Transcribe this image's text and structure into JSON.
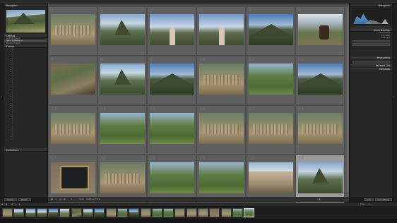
{
  "window": {
    "title": ""
  },
  "left_panel": {
    "navigator_label": "Navigator",
    "catalog_label": "Catalog",
    "catalog_items": [
      {
        "label": "All Photographs",
        "count": "",
        "selected": false
      },
      {
        "label": "Quick Collection +",
        "count": "",
        "selected": true
      },
      {
        "label": "Previous Import",
        "count": "",
        "selected": false
      }
    ],
    "folders_label": "Folders",
    "folder_tree": [
      "",
      "",
      "",
      "",
      "",
      "",
      "",
      "",
      "",
      "",
      "",
      "",
      "",
      "",
      "",
      "",
      "",
      "",
      "",
      "",
      "",
      "",
      "",
      "",
      "",
      "",
      "",
      "",
      "",
      "",
      "",
      "",
      "",
      "",
      "",
      "",
      "",
      "",
      "",
      "",
      ""
    ],
    "collections_label": "Collections",
    "buttons": {
      "import": "Import...",
      "export": "Export..."
    }
  },
  "grid": {
    "header": "",
    "cells": [
      {
        "index": "1",
        "kind": "k-ruin",
        "selected": false
      },
      {
        "index": "2",
        "kind": "k-peak",
        "selected": false
      },
      {
        "index": "3",
        "kind": "k-person",
        "selected": false
      },
      {
        "index": "4",
        "kind": "k-person",
        "selected": false
      },
      {
        "index": "5",
        "kind": "k-mtn",
        "selected": false
      },
      {
        "index": "6",
        "kind": "k-llama",
        "selected": false
      },
      {
        "index": "7",
        "kind": "k-wall",
        "selected": false
      },
      {
        "index": "8",
        "kind": "k-peak",
        "selected": false
      },
      {
        "index": "9",
        "kind": "k-mtn",
        "selected": false
      },
      {
        "index": "10",
        "kind": "k-ruin",
        "selected": false
      },
      {
        "index": "11",
        "kind": "k-terr",
        "selected": false
      },
      {
        "index": "12",
        "kind": "k-mtn",
        "selected": false
      },
      {
        "index": "13",
        "kind": "k-ruin",
        "selected": false
      },
      {
        "index": "14",
        "kind": "k-terr",
        "selected": false
      },
      {
        "index": "15",
        "kind": "k-terr",
        "selected": false
      },
      {
        "index": "16",
        "kind": "k-ruin",
        "selected": false
      },
      {
        "index": "17",
        "kind": "k-ruin",
        "selected": false
      },
      {
        "index": "18",
        "kind": "k-ruin",
        "selected": false
      },
      {
        "index": "19",
        "kind": "k-sign",
        "selected": false
      },
      {
        "index": "20",
        "kind": "k-ruin",
        "selected": false
      },
      {
        "index": "21",
        "kind": "k-terr",
        "selected": false
      },
      {
        "index": "22",
        "kind": "k-terr",
        "selected": false
      },
      {
        "index": "23",
        "kind": "k-stone",
        "selected": false
      },
      {
        "index": "24",
        "kind": "k-peak",
        "selected": true
      }
    ]
  },
  "right_panel": {
    "histogram_label": "Histogram",
    "quick_develop_label": "Quick Develop",
    "rows": [
      {
        "label": "Saved Preset",
        "value": ""
      },
      {
        "label": "Crop Ratio",
        "value": ""
      },
      {
        "label": "Treatment",
        "value": ""
      }
    ],
    "keywording_label": "Keywording",
    "keyword_list_label": "Keyword List",
    "metadata_label": "Metadata",
    "metadata_rows": [
      {
        "label": "",
        "value": ""
      },
      {
        "label": "",
        "value": ""
      },
      {
        "label": "",
        "value": ""
      },
      {
        "label": "",
        "value": ""
      },
      {
        "label": "",
        "value": ""
      },
      {
        "label": "",
        "value": ""
      },
      {
        "label": "",
        "value": ""
      },
      {
        "label": "",
        "value": ""
      },
      {
        "label": "",
        "value": ""
      },
      {
        "label": "",
        "value": ""
      },
      {
        "label": "",
        "value": ""
      },
      {
        "label": "",
        "value": ""
      },
      {
        "label": "",
        "value": ""
      },
      {
        "label": "",
        "value": ""
      },
      {
        "label": "",
        "value": ""
      },
      {
        "label": "",
        "value": ""
      },
      {
        "label": "",
        "value": ""
      },
      {
        "label": "",
        "value": ""
      },
      {
        "label": "",
        "value": ""
      },
      {
        "label": "",
        "value": ""
      },
      {
        "label": "",
        "value": ""
      }
    ],
    "buttons": {
      "sync": "Sync",
      "sync_settings": "Sync Settings"
    }
  },
  "toolbar": {
    "sort_label": "Sort:",
    "sort_value": "Capture Time"
  },
  "filmstrip_bar": {
    "source": "",
    "filter_label": "Filter:"
  },
  "filmstrip": [
    "k-ruin",
    "k-peak",
    "k-person",
    "k-person",
    "k-mtn",
    "k-llama",
    "k-wall",
    "k-peak",
    "k-mtn",
    "k-ruin",
    "k-terr",
    "k-mtn",
    "k-ruin",
    "k-terr",
    "k-terr",
    "k-ruin",
    "k-ruin",
    "k-ruin",
    "k-sign",
    "k-ruin",
    "k-terr",
    "k-terr"
  ],
  "filmstrip_selected_index": 21
}
